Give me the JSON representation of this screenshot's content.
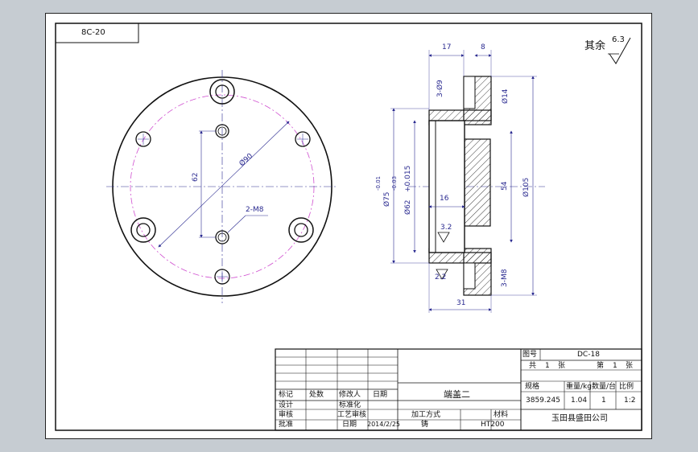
{
  "header": {
    "code": "8C-20"
  },
  "roughness": {
    "symbol_text": "其余",
    "value": "6.3"
  },
  "front_view": {
    "dims": {
      "pcd": "Ø90",
      "height": "62",
      "holes": "2-M8"
    }
  },
  "section_view": {
    "dims": {
      "top_17": "17",
      "top_8": "8",
      "counter_bore": "3-Ø9",
      "d14": "Ø14",
      "d75": "Ø75",
      "d75_tol_upper": "-0.01",
      "d75_tol_lower": "-0.03",
      "d62": "Ø62",
      "d62_tol": "+0.015",
      "d105": "Ø105",
      "d54": "54",
      "w16": "16",
      "thread": "3-M8",
      "r32": "3.2",
      "r22": "2.2",
      "w31": "31"
    }
  },
  "title_block": {
    "drawing_no_label": "图号",
    "drawing_no": "DC-18",
    "sheets_total_label": "共",
    "sheets_total": "1",
    "sheets_unit": "张",
    "sheet_no_label": "第",
    "sheet_no": "1",
    "sheet_no_unit": "张",
    "part_name": "端盖二",
    "col_weight_label": "重量/kg",
    "col_qty_label": "数量/台",
    "col_scale_label": "比例",
    "col_spec_label": "规格",
    "spec_value": "3859.245",
    "weight_value": "1.04",
    "qty_value": "1",
    "scale_value": "1:2",
    "company": "玉田县盛田公司",
    "rev_headers": [
      "标记",
      "处数",
      "修改人",
      "日期"
    ],
    "design_label": "设计",
    "design_value": "标准化",
    "review_label": "审核",
    "review_value": "工艺审核",
    "approve_label": "批准",
    "date_label": "日期",
    "date_value": "2014/2/25",
    "process_label": "加工方式",
    "process_value": "铸",
    "material_label": "材料",
    "material_value": "HT200"
  }
}
